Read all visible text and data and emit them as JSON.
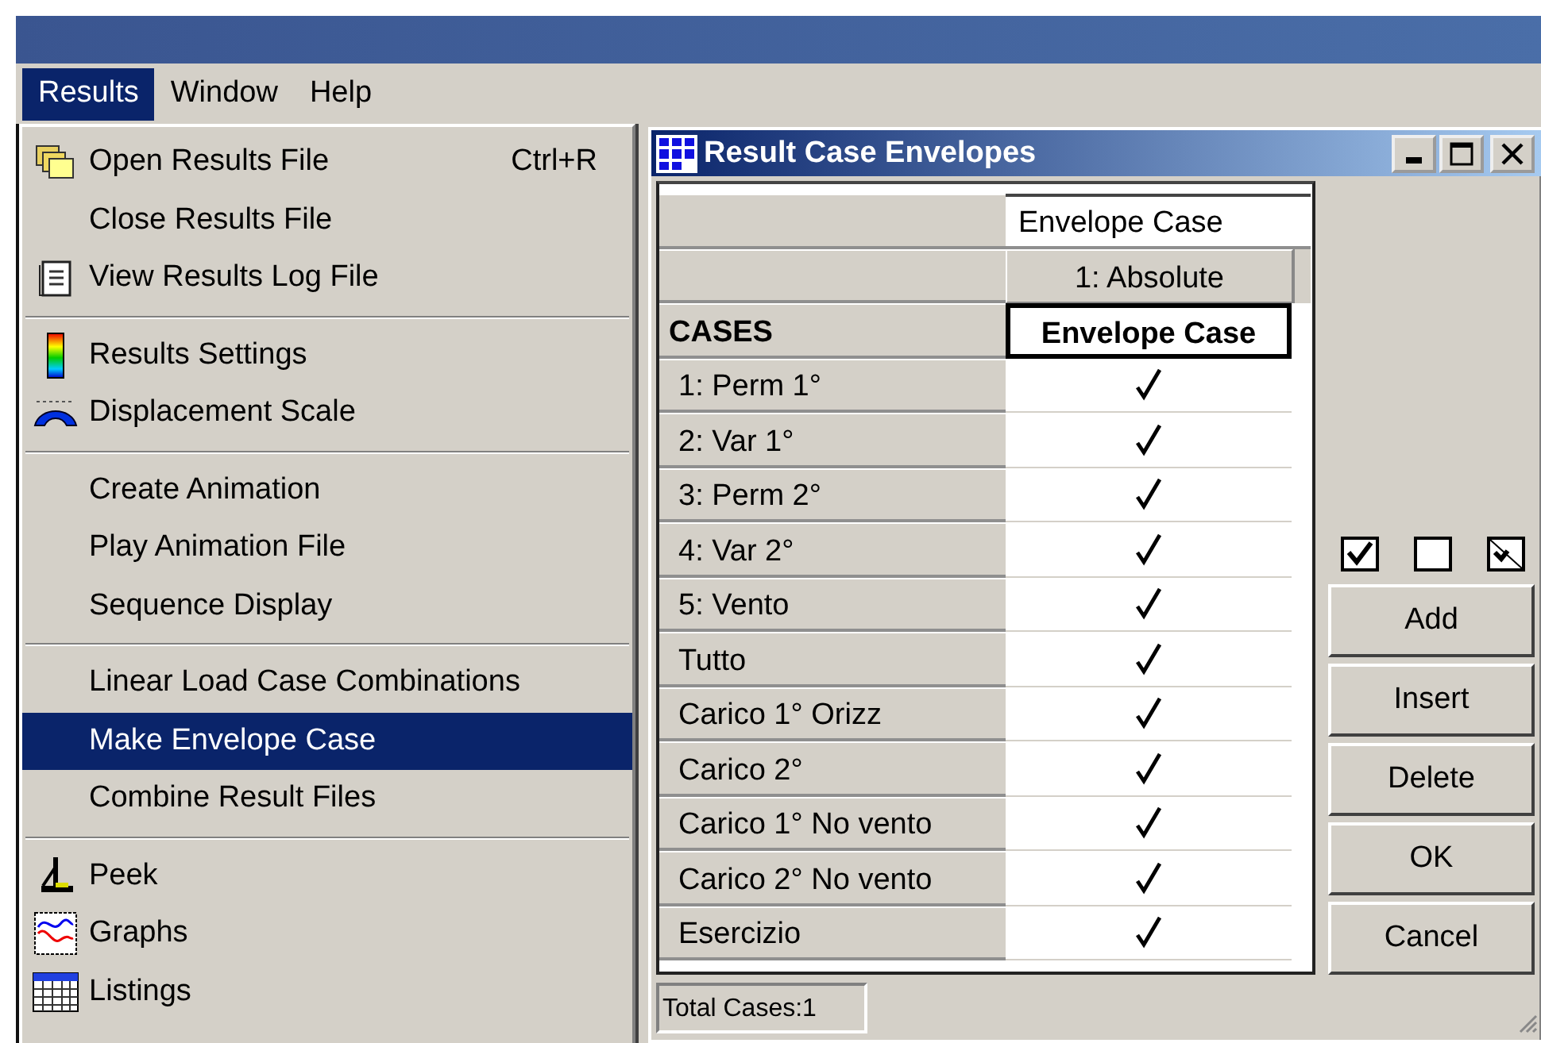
{
  "menubar": [
    {
      "label": "Results",
      "selected": true
    },
    {
      "label": "Window",
      "selected": false
    },
    {
      "label": "Help",
      "selected": false
    }
  ],
  "dropdown": {
    "groups": [
      [
        {
          "label": "Open Results File",
          "shortcut": "Ctrl+R",
          "selected": false
        },
        {
          "label": "Close Results File",
          "selected": false
        },
        {
          "label": "View Results Log File",
          "selected": false
        }
      ],
      [
        {
          "label": "Results Settings",
          "selected": false
        },
        {
          "label": "Displacement Scale",
          "selected": false
        }
      ],
      [
        {
          "label": "Create Animation",
          "selected": false
        },
        {
          "label": "Play Animation File",
          "selected": false
        },
        {
          "label": "Sequence Display",
          "selected": false
        }
      ],
      [
        {
          "label": "Linear Load Case Combinations",
          "selected": false
        },
        {
          "label": "Make Envelope Case",
          "selected": true
        },
        {
          "label": "Combine Result Files",
          "selected": false
        }
      ],
      [
        {
          "label": "Peek",
          "selected": false
        },
        {
          "label": "Graphs",
          "selected": false
        },
        {
          "label": "Listings",
          "selected": false
        }
      ]
    ]
  },
  "dialog": {
    "title": "Result Case Envelopes",
    "name_field": "Envelope Case",
    "mode_button": "1: Absolute",
    "cases_header": "CASES",
    "column_header": "Envelope Case",
    "rows": [
      {
        "name": "1: Perm 1°",
        "checked": true
      },
      {
        "name": "2: Var 1°",
        "checked": true
      },
      {
        "name": "3: Perm 2°",
        "checked": true
      },
      {
        "name": "4: Var 2°",
        "checked": true
      },
      {
        "name": "5: Vento",
        "checked": true
      },
      {
        "name": "Tutto",
        "checked": true
      },
      {
        "name": "Carico 1° Orizz",
        "checked": true
      },
      {
        "name": "Carico 2°",
        "checked": true
      },
      {
        "name": "Carico 1° No vento",
        "checked": true
      },
      {
        "name": "Carico 2° No vento",
        "checked": true
      },
      {
        "name": "Esercizio",
        "checked": true
      }
    ],
    "buttons": [
      "Add",
      "Insert",
      "Delete",
      "OK",
      "Cancel"
    ],
    "status": "Total Cases:1"
  }
}
